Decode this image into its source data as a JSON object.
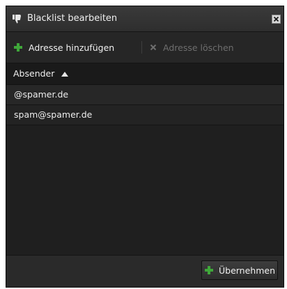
{
  "window": {
    "title": "Blacklist bearbeiten",
    "title_icon": "thumbs-down-icon",
    "close_icon": "close-icon"
  },
  "toolbar": {
    "add_label": "Adresse hinzufügen",
    "add_icon": "plus-icon",
    "delete_label": "Adresse löschen",
    "delete_icon": "x-icon",
    "delete_enabled": false
  },
  "grid": {
    "column_header": "Absender",
    "sort": "ascending",
    "rows": [
      {
        "sender": "@spamer.de"
      },
      {
        "sender": "spam@spamer.de"
      }
    ]
  },
  "footer": {
    "apply_label": "Übernehmen",
    "apply_icon": "plus-icon"
  },
  "colors": {
    "accent_green": "#3fa73a",
    "background": "#1f1f1f",
    "disabled_text": "#6e6e6e"
  }
}
